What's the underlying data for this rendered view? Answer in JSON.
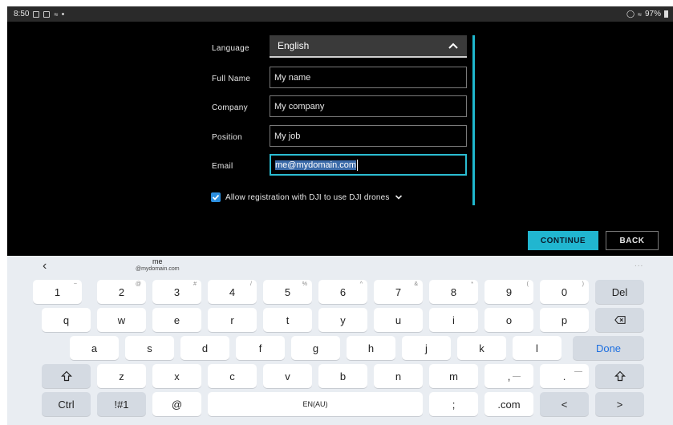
{
  "status_bar": {
    "time": "8:50",
    "battery": "97%"
  },
  "form": {
    "language": {
      "label": "Language",
      "value": "English"
    },
    "full_name": {
      "label": "Full Name",
      "value": "My name"
    },
    "company": {
      "label": "Company",
      "value": "My company"
    },
    "position": {
      "label": "Position",
      "value": "My job"
    },
    "email": {
      "label": "Email",
      "value": "me@mydomain.com"
    },
    "allow_registration": {
      "label": "Allow registration with DJI to use DJI drones",
      "checked": true
    }
  },
  "buttons": {
    "continue": "CONTINUE",
    "back": "BACK"
  },
  "keyboard": {
    "suggestion": {
      "main": "me",
      "sub": "@mydomain.com"
    },
    "more": "...",
    "row1": [
      {
        "k": "1",
        "s": "~"
      },
      {
        "k": "2",
        "s": "@"
      },
      {
        "k": "3",
        "s": "#"
      },
      {
        "k": "4",
        "s": "/"
      },
      {
        "k": "5",
        "s": "%"
      },
      {
        "k": "6",
        "s": "^"
      },
      {
        "k": "7",
        "s": "&"
      },
      {
        "k": "8",
        "s": "*"
      },
      {
        "k": "9",
        "s": "("
      },
      {
        "k": "0",
        "s": ")"
      }
    ],
    "del": "Del",
    "row2": [
      "q",
      "w",
      "e",
      "r",
      "t",
      "y",
      "u",
      "i",
      "o",
      "p"
    ],
    "row3": [
      "a",
      "s",
      "d",
      "f",
      "g",
      "h",
      "j",
      "k",
      "l"
    ],
    "done": "Done",
    "row4": [
      "z",
      "x",
      "c",
      "v",
      "b",
      "n",
      "m"
    ],
    "comma": ",",
    "comma_sub": "—",
    "period": ".",
    "period_sub": "—",
    "ctrl": "Ctrl",
    "symbols": "!#1",
    "at": "@",
    "space": "EN(AU)",
    "semicolon": ";",
    "dotcom": ".com",
    "left_arrow": "<",
    "right_arrow": ">"
  },
  "colors": {
    "accent": "#21b6d0",
    "checkbox": "#2b8fe0",
    "keyboard_bg": "#e9edf2"
  }
}
